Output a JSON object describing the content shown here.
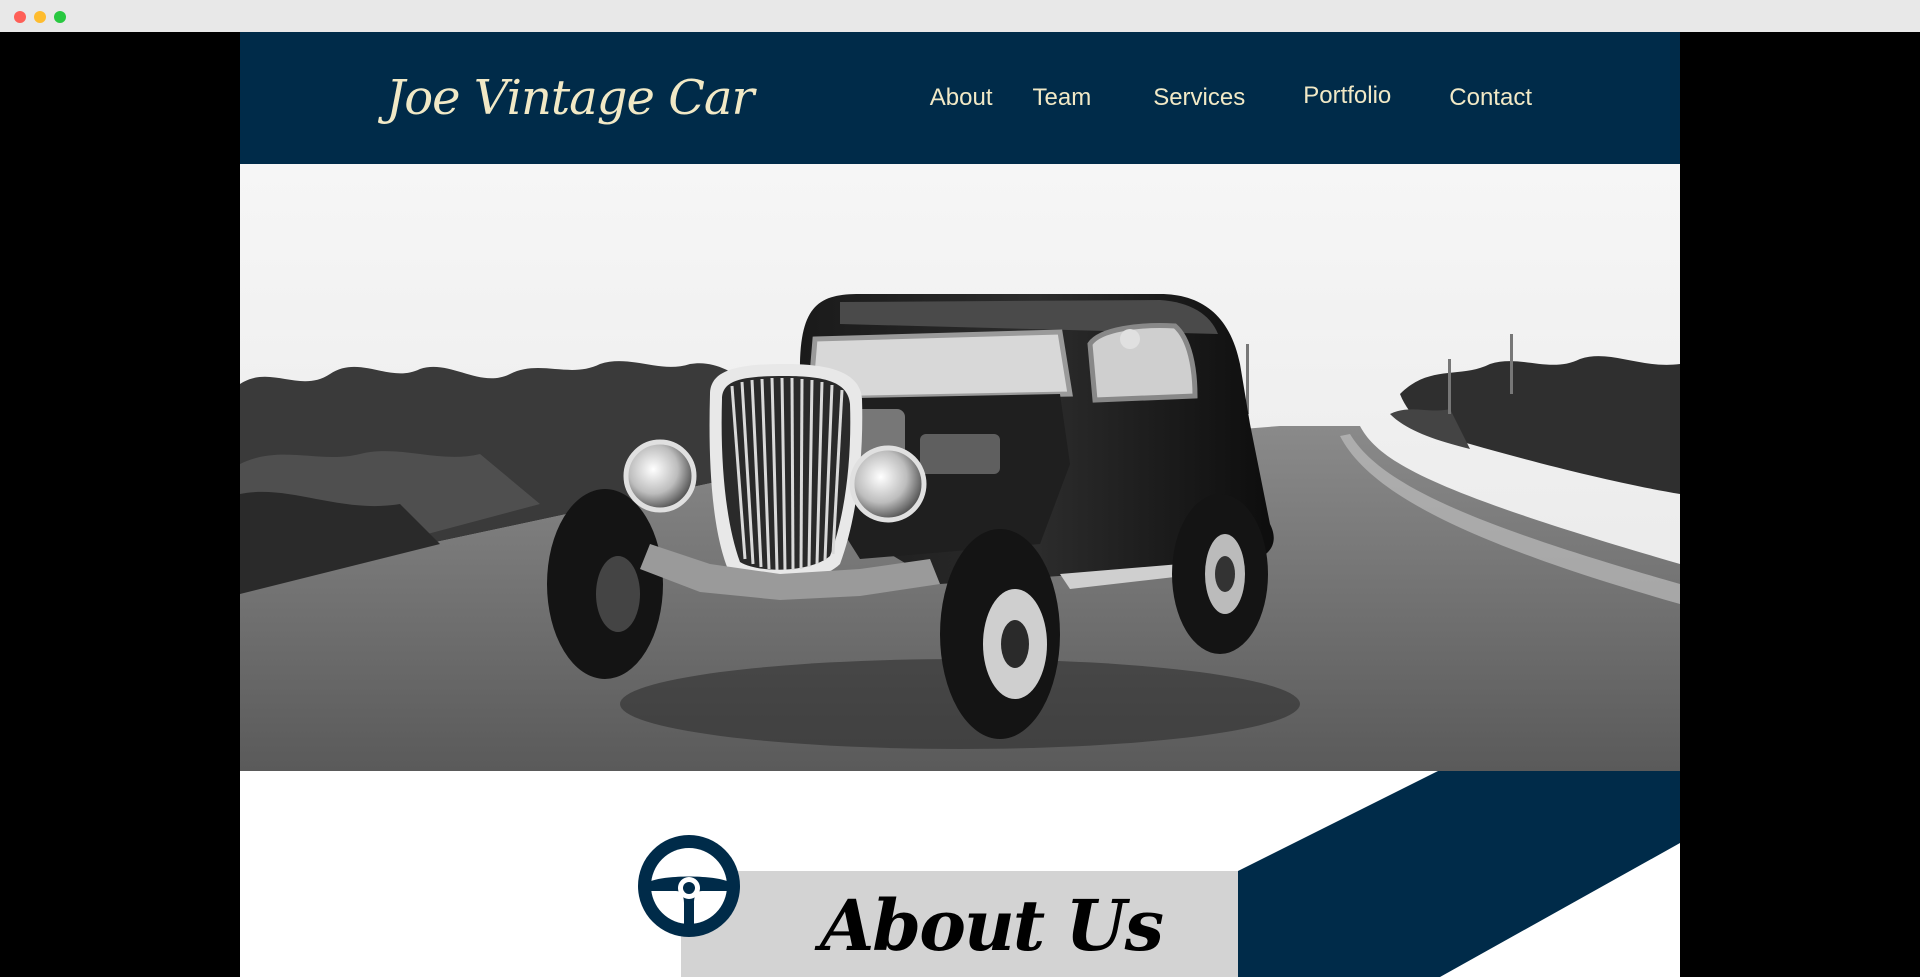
{
  "site": {
    "logo": "Joe Vintage Car"
  },
  "nav": {
    "items": [
      {
        "label": "About"
      },
      {
        "label": "Team"
      },
      {
        "label": "Services"
      },
      {
        "label": "Portfolio"
      },
      {
        "label": "Contact"
      }
    ]
  },
  "hero": {
    "image_subject": "black-and-white photo of a vintage hot rod coupe on a country road"
  },
  "about": {
    "title": "About Us",
    "icon": "steering-wheel-icon"
  },
  "colors": {
    "brand_navy": "#002b49",
    "nav_text": "#f1e9c6",
    "about_box": "#d3d3d3"
  }
}
